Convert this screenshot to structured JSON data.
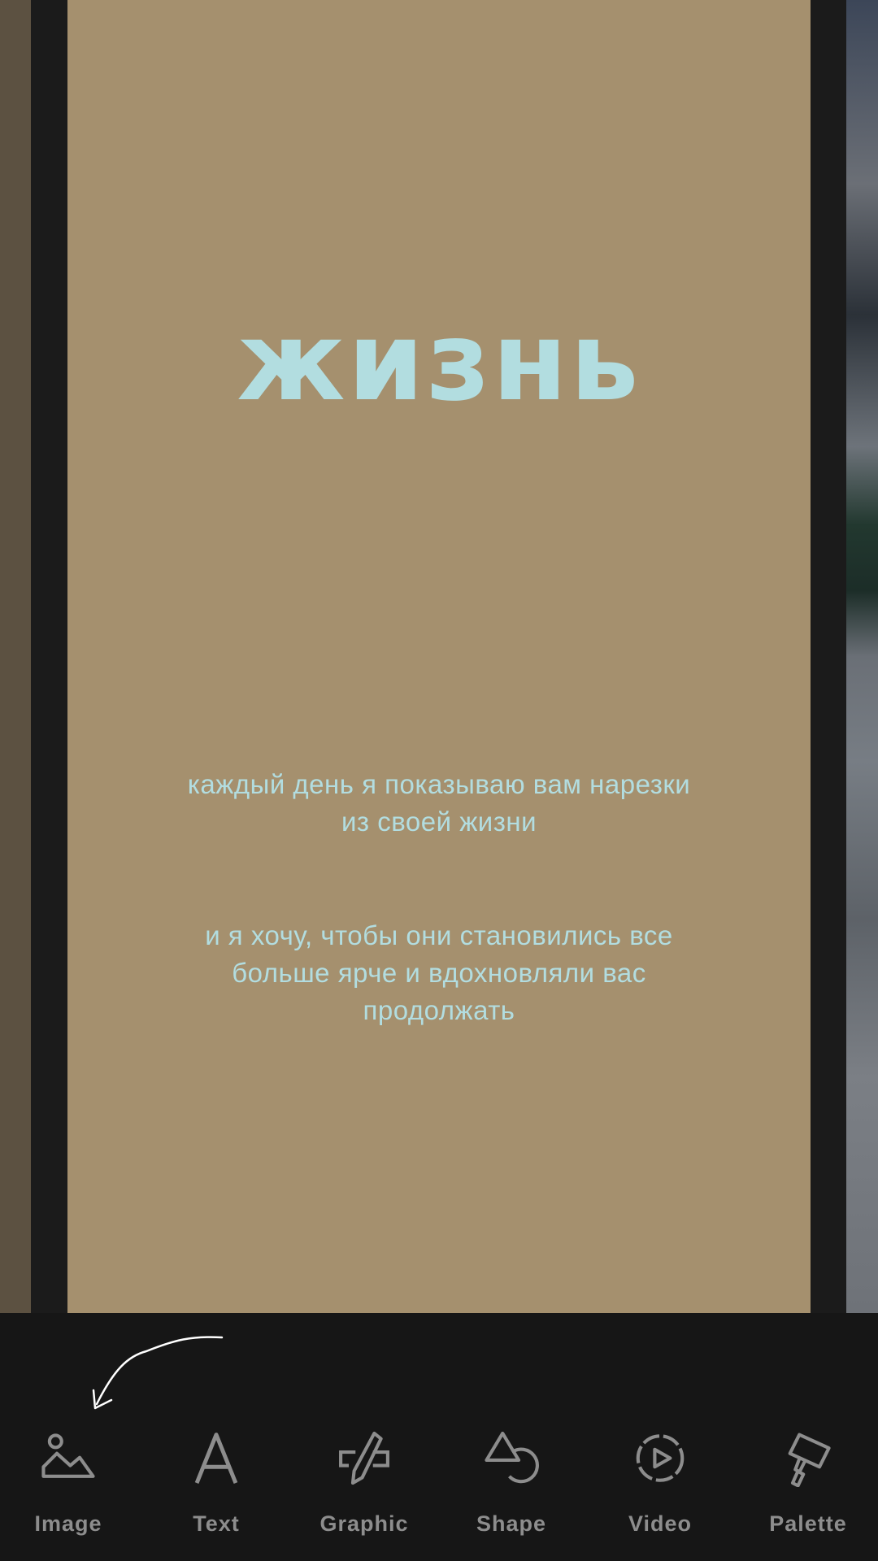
{
  "design": {
    "headline": "жизнь",
    "paragraph_1": "каждый день я показываю вам нарезки из своей жизни",
    "paragraph_2": "и я хочу, чтобы они становились все больше ярче и вдохновляли вас продолжать",
    "page_background": "#a5906e",
    "text_color": "#b2dde0"
  },
  "toolbar": {
    "items": [
      {
        "label": "Image",
        "icon": "image-icon"
      },
      {
        "label": "Text",
        "icon": "text-icon"
      },
      {
        "label": "Graphic",
        "icon": "graphic-icon"
      },
      {
        "label": "Shape",
        "icon": "shape-icon"
      },
      {
        "label": "Video",
        "icon": "video-icon"
      },
      {
        "label": "Palette",
        "icon": "palette-icon"
      }
    ]
  }
}
